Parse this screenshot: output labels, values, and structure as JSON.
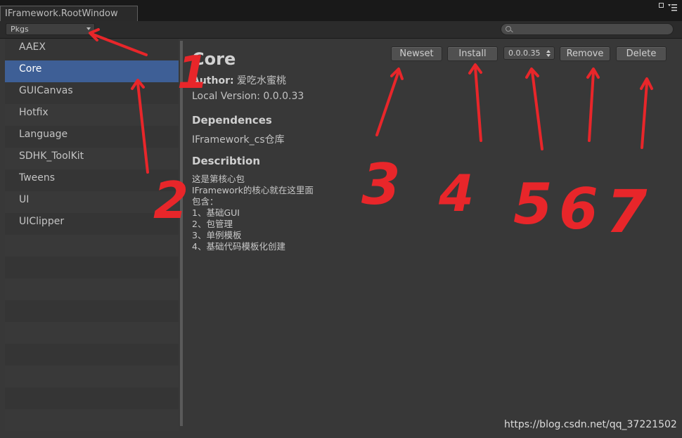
{
  "window": {
    "title": "IFramework.RootWindow"
  },
  "toolbar": {
    "dropdown_value": "Pkgs",
    "search_placeholder": ""
  },
  "sidebar": {
    "items": [
      {
        "label": "AAEX"
      },
      {
        "label": "Core"
      },
      {
        "label": "GUICanvas"
      },
      {
        "label": "Hotfix"
      },
      {
        "label": "Language"
      },
      {
        "label": "SDHK_ToolKit"
      },
      {
        "label": "Tweens"
      },
      {
        "label": "UI"
      },
      {
        "label": "UIClipper"
      }
    ],
    "selected": "Core"
  },
  "detail": {
    "title": "Core",
    "author_label": "Author:",
    "author": "爱吃水蜜桃",
    "local_version_label": "Local Version:",
    "local_version": "0.0.0.33",
    "dependences_label": "Dependences",
    "dependence": "IFramework_cs仓库",
    "description_label": "Describtion",
    "description_lines": [
      "这是第核心包",
      "IFramework的核心就在这里面",
      "包含：",
      "1、基础GUI",
      "2、包管理",
      "3、单例模板",
      "4、基础代码模板化创建"
    ]
  },
  "buttons": {
    "newset": "Newset",
    "install": "Install",
    "version": "0.0.0.35",
    "remove": "Remove",
    "delete": "Delete"
  },
  "annotations": {
    "numbers": [
      "1",
      "2",
      "3",
      "4",
      "5",
      "6",
      "7"
    ],
    "color": "#e8262a"
  },
  "watermark": "https://blog.csdn.net/qq_37221502",
  "colors": {
    "selection": "#3e5f96",
    "background": "#383838"
  }
}
